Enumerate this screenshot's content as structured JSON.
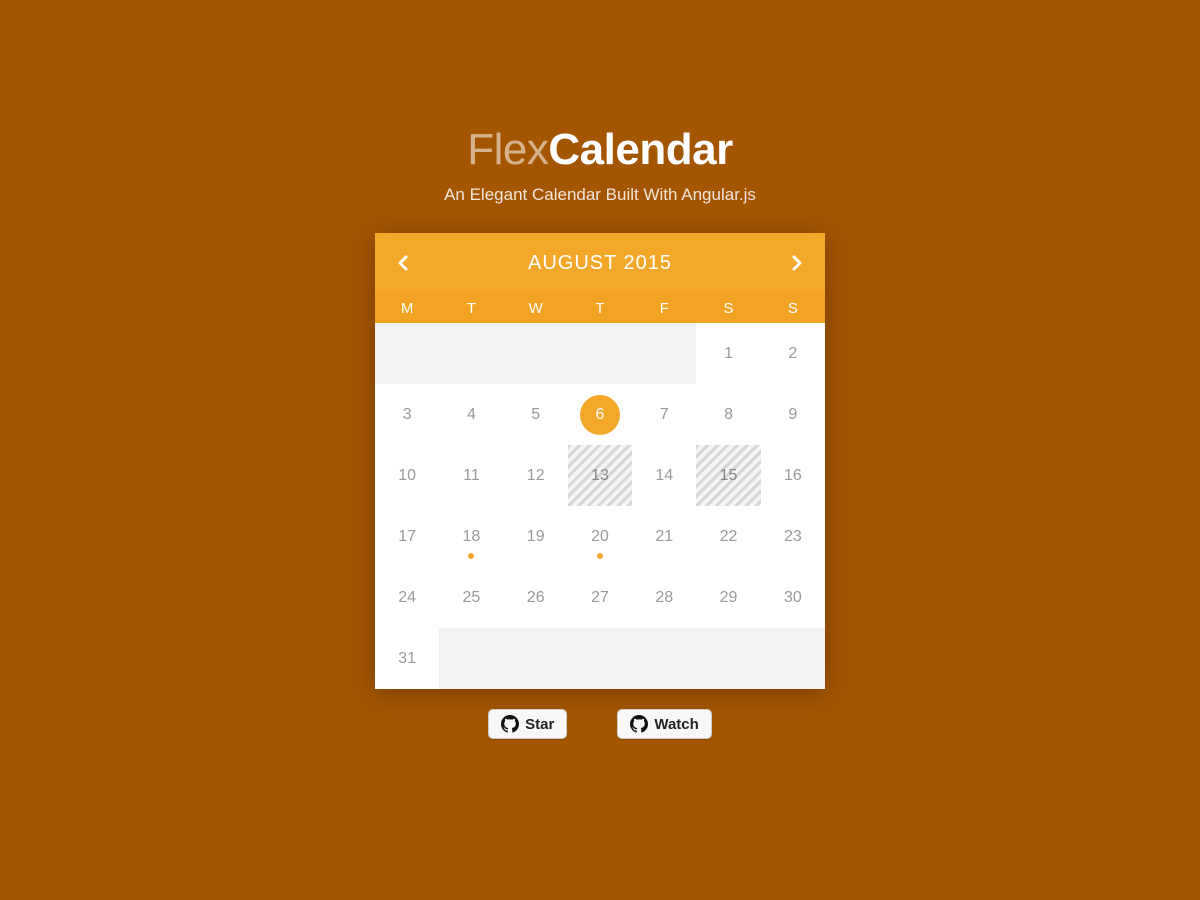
{
  "header": {
    "title_thin": "Flex",
    "title_bold": "Calendar",
    "subtitle": "An Elegant Calendar Built With Angular.js"
  },
  "calendar": {
    "month_label": "AUGUST 2015",
    "weekdays": [
      "M",
      "T",
      "W",
      "T",
      "F",
      "S",
      "S"
    ],
    "leading_blanks": 5,
    "days": [
      1,
      2,
      3,
      4,
      5,
      6,
      7,
      8,
      9,
      10,
      11,
      12,
      13,
      14,
      15,
      16,
      17,
      18,
      19,
      20,
      21,
      22,
      23,
      24,
      25,
      26,
      27,
      28,
      29,
      30,
      31
    ],
    "selected": 6,
    "disabled": [
      13,
      15
    ],
    "events": [
      18,
      20
    ],
    "trailing_blanks": 6
  },
  "github": {
    "star_label": "Star",
    "watch_label": "Watch"
  },
  "colors": {
    "page_bg": "#a35500",
    "accent": "#f4a82a"
  }
}
